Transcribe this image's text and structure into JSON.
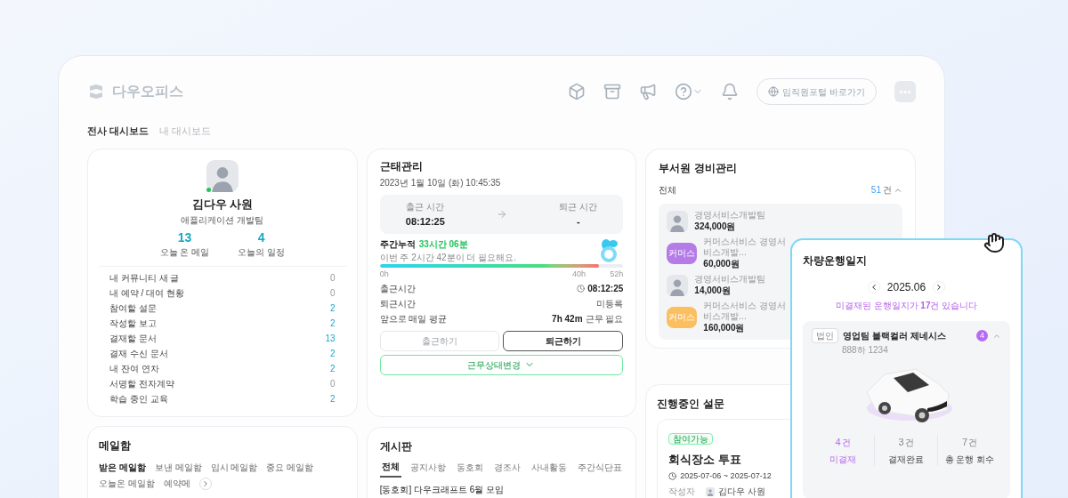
{
  "header": {
    "logo_text": "다우오피스",
    "portal_button": "임직원포털 바로가기"
  },
  "dashboard_tabs": [
    {
      "label": "전사 대시보드",
      "selected": true
    },
    {
      "label": "내 대시보드",
      "selected": false
    }
  ],
  "profile": {
    "name": "김다우 사원",
    "team": "애플리케이션 개발팀",
    "online": true,
    "stats": [
      {
        "value": "13",
        "label": "오늘 온 메일"
      },
      {
        "value": "4",
        "label": "오늘의 일정"
      }
    ],
    "rows": [
      {
        "label": "내 커뮤니티 새 글",
        "count": "0",
        "highlighted": false
      },
      {
        "label": "내 예약 / 대여 현황",
        "count": "0",
        "highlighted": false
      },
      {
        "label": "참여할 설문",
        "count": "2",
        "highlighted": true
      },
      {
        "label": "작성할 보고",
        "count": "2",
        "highlighted": true
      },
      {
        "label": "결재할 문서",
        "count": "13",
        "highlighted": true
      },
      {
        "label": "결재 수신 문서",
        "count": "2",
        "highlighted": true
      },
      {
        "label": "내 잔여 연차",
        "count": "2",
        "highlighted": true
      },
      {
        "label": "서명할 전자계약",
        "count": "0",
        "highlighted": false
      },
      {
        "label": "학습 중인 교육",
        "count": "2",
        "highlighted": true
      }
    ]
  },
  "mail": {
    "title": "메일함",
    "tabs": [
      {
        "label": "받은 메일함",
        "selected": true
      },
      {
        "label": "보낸 메일함",
        "selected": false
      },
      {
        "label": "임시 메일함",
        "selected": false
      },
      {
        "label": "중요 메일함",
        "selected": false
      },
      {
        "label": "오늘온 메일함",
        "selected": false
      },
      {
        "label": "예약메",
        "selected": false
      }
    ]
  },
  "attendance": {
    "title": "근태관리",
    "datetime": "2023년 1월 10일 (화) 10:45:35",
    "clock_in_label": "출근 시간",
    "clock_in_value": "08:12:25",
    "clock_out_label": "퇴근 시간",
    "clock_out_value": "-",
    "weekly_label": "주간누적",
    "weekly_value": "33시간 06분",
    "weekly_note": "이번 주 2시간 42분이 더 필요해요.",
    "level": 0.9,
    "ticks": [
      "0h",
      "40h",
      "52h"
    ],
    "details": [
      {
        "kind": "time",
        "label": "출근시간",
        "value": "08:12:25"
      },
      {
        "kind": "text",
        "label": "퇴근시간",
        "value": "미등록"
      },
      {
        "kind": "duration",
        "label": "앞으로 매일 평균",
        "value": "7h 42m",
        "suffix": "근무 필요"
      }
    ],
    "buttons": [
      {
        "label": "출근하기",
        "disabled": true
      },
      {
        "label": "퇴근하기",
        "disabled": false
      }
    ],
    "status_button": "근무상태변경"
  },
  "board": {
    "title": "게시판",
    "tabs": [
      {
        "label": "전체",
        "selected": true
      },
      {
        "label": "공지사항",
        "selected": false
      },
      {
        "label": "동호회",
        "selected": false
      },
      {
        "label": "경조사",
        "selected": false
      },
      {
        "label": "사내활동",
        "selected": false
      },
      {
        "label": "주간식단표",
        "selected": false
      }
    ],
    "posts": [
      "[동호회] 다우크래프트 6월 모임"
    ]
  },
  "expenses": {
    "title": "부서원 경비관리",
    "filter": "전체",
    "count": "51",
    "count_unit": "건",
    "items": [
      {
        "kind": "photo",
        "dept": "경영서비스개발팀",
        "amount": "324,000원"
      },
      {
        "kind": "badge",
        "badge": "커머스",
        "color": "#b57be6",
        "dept": "커머스서비스 경영서비스개발...",
        "amount": "60,000원"
      },
      {
        "kind": "photo",
        "dept": "경영서비스개발팀",
        "amount": "14,000원"
      },
      {
        "kind": "badge",
        "badge": "커머스",
        "color": "#fbbf5f",
        "dept": "커머스서비스 경영서비스개발...",
        "amount": "160,000원"
      }
    ]
  },
  "survey": {
    "title": "진행중인 설문",
    "tag": "참여가능",
    "name": "회식장소 투표",
    "period": "2025-07-06 ~ 2025-07-12",
    "author_label": "작성자",
    "author": "김다우 사원"
  },
  "vehicle": {
    "title": "차량운행일지",
    "month": "2025.06",
    "notice": "미결재된 운행일지가 **17**건 있습니다",
    "car_tag": "법인",
    "car_name": "영업팀 블랙컬러 제네시스",
    "plate": "888하 1234",
    "count_badge": "4",
    "stats": [
      {
        "value": "4",
        "unit": "건",
        "label": "미결재",
        "selected": true
      },
      {
        "value": "3",
        "unit": "건",
        "label": "결재완료",
        "selected": false
      },
      {
        "value": "7",
        "unit": "건",
        "label": "총 운행 회수",
        "selected": false
      }
    ]
  }
}
